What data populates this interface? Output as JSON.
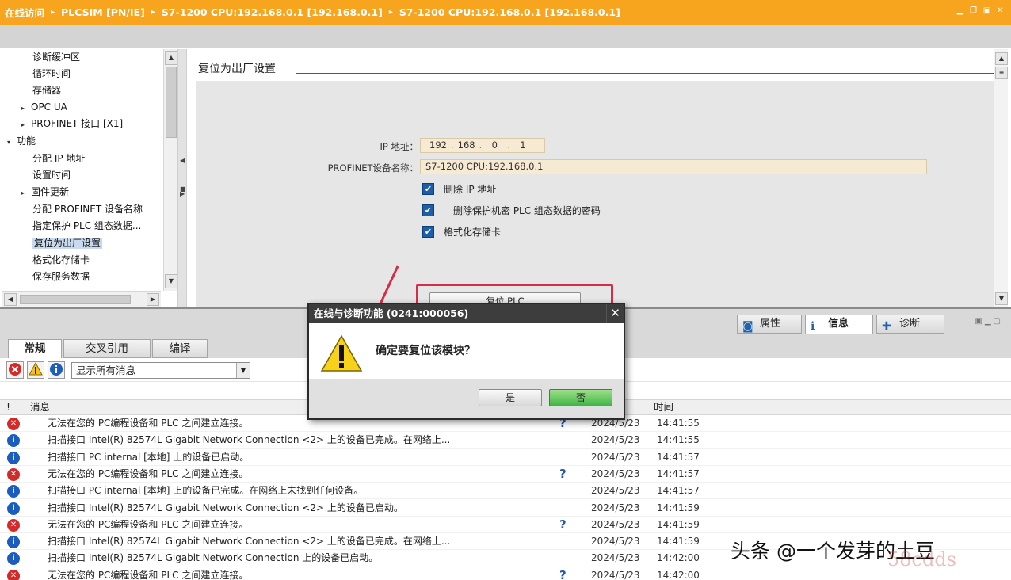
{
  "titlebar": {
    "crumbs": [
      "在线访问",
      "PLCSIM [PN/IE]",
      "S7-1200 CPU:192.168.0.1 [192.168.0.1]",
      "S7-1200 CPU:192.168.0.1 [192.168.0.1]"
    ],
    "sep": "▸"
  },
  "tree": {
    "items": [
      {
        "label": "诊断缓冲区",
        "indent": 1
      },
      {
        "label": "循环时间",
        "indent": 1
      },
      {
        "label": "存储器",
        "indent": 1
      },
      {
        "label": "OPC UA",
        "indent": 1,
        "expander": "▸"
      },
      {
        "label": "PROFINET 接口 [X1]",
        "indent": 1,
        "expander": "▸"
      },
      {
        "label": "功能",
        "indent": 0,
        "expander": "▾"
      },
      {
        "label": "分配 IP 地址",
        "indent": 1
      },
      {
        "label": "设置时间",
        "indent": 1
      },
      {
        "label": "固件更新",
        "indent": 1,
        "expander": "▸"
      },
      {
        "label": "分配 PROFINET 设备名称",
        "indent": 1
      },
      {
        "label": "指定保护 PLC 组态数据...",
        "indent": 1
      },
      {
        "label": "复位为出厂设置",
        "indent": 1,
        "selected": true
      },
      {
        "label": "格式化存储卡",
        "indent": 1
      },
      {
        "label": "保存服务数据",
        "indent": 1
      }
    ]
  },
  "settings": {
    "section_title": "复位为出厂设置",
    "ip_label": "IP 地址：",
    "ip": [
      "192",
      "168",
      "0",
      "1"
    ],
    "profinet_label": "PROFINET设备名称：",
    "profinet_value": "S7-1200 CPU:192.168.0.1",
    "options": [
      {
        "label": "删除 IP 地址",
        "checked": true
      },
      {
        "label": "删除保护机密 PLC 组态数据的密码",
        "checked": true
      },
      {
        "label": "格式化存储卡",
        "checked": true
      }
    ],
    "reset_button": "复位 PLC"
  },
  "inspector": {
    "tabs": [
      {
        "label": "属性",
        "icon": "properties-icon"
      },
      {
        "label": "信息",
        "icon": "info-icon",
        "active": true
      },
      {
        "label": "诊断",
        "icon": "diagnostics-icon"
      }
    ],
    "subtabs": [
      {
        "label": "常规",
        "active": true
      },
      {
        "label": "交叉引用"
      },
      {
        "label": "编译"
      }
    ],
    "filter_value": "显示所有消息",
    "columns": {
      "bang": "!",
      "message": "消息",
      "time": "时间"
    },
    "rows": [
      {
        "type": "error",
        "message": "无法在您的 PC编程设备和 PLC 之间建立连接。",
        "help": "?",
        "date": "2024/5/23",
        "time": "14:41:55"
      },
      {
        "type": "info",
        "message": "扫描接口 Intel(R) 82574L Gigabit Network Connection <2> 上的设备已完成。在网络上...",
        "help": "",
        "date": "2024/5/23",
        "time": "14:41:55"
      },
      {
        "type": "info",
        "message": "扫描接口 PC internal [本地] 上的设备已启动。",
        "help": "",
        "date": "2024/5/23",
        "time": "14:41:57"
      },
      {
        "type": "error",
        "message": "无法在您的 PC编程设备和 PLC 之间建立连接。",
        "help": "?",
        "date": "2024/5/23",
        "time": "14:41:57"
      },
      {
        "type": "info",
        "message": "扫描接口 PC internal [本地] 上的设备已完成。在网络上未找到任何设备。",
        "help": "",
        "date": "2024/5/23",
        "time": "14:41:57"
      },
      {
        "type": "info",
        "message": "扫描接口 Intel(R) 82574L Gigabit Network Connection <2> 上的设备已启动。",
        "help": "",
        "date": "2024/5/23",
        "time": "14:41:59"
      },
      {
        "type": "error",
        "message": "无法在您的 PC编程设备和 PLC 之间建立连接。",
        "help": "?",
        "date": "2024/5/23",
        "time": "14:41:59"
      },
      {
        "type": "info",
        "message": "扫描接口 Intel(R) 82574L Gigabit Network Connection <2> 上的设备已完成。在网络上...",
        "help": "",
        "date": "2024/5/23",
        "time": "14:41:59"
      },
      {
        "type": "info",
        "message": "扫描接口 Intel(R) 82574L Gigabit Network Connection 上的设备已启动。",
        "help": "",
        "date": "2024/5/23",
        "time": "14:42:00"
      },
      {
        "type": "error",
        "message": "无法在您的 PC编程设备和 PLC 之间建立连接。",
        "help": "?",
        "date": "2024/5/23",
        "time": "14:42:00"
      }
    ]
  },
  "dialog": {
    "title": "在线与诊断功能 (0241:000056)",
    "message": "确定要复位该模块？",
    "yes": "是",
    "no": "否",
    "close": "✕"
  },
  "colors": {
    "accent": "#f7a41e",
    "highlight": "#d52c4a",
    "error": "#d52a2a",
    "info": "#1a5dbf"
  },
  "watermark": "头条 @一个发芽的土豆",
  "watermark2": "58cdds"
}
